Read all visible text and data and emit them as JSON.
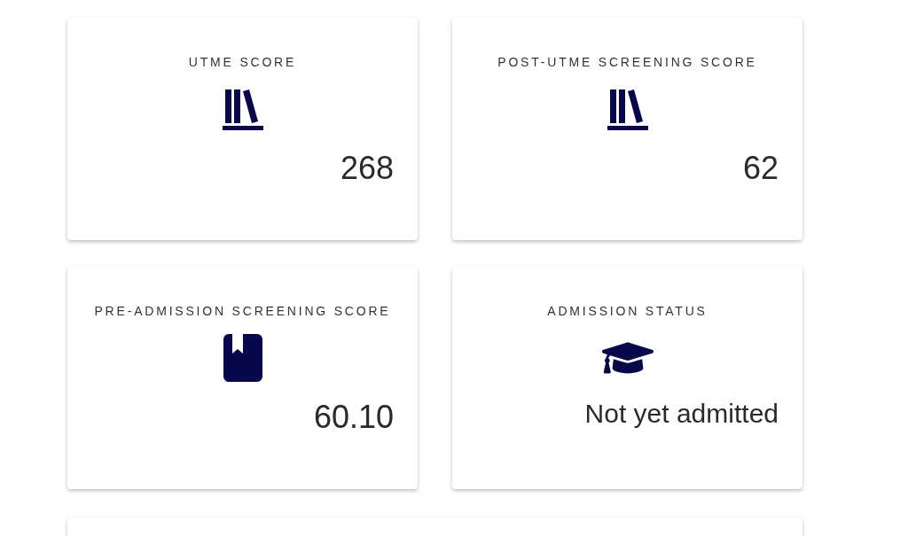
{
  "cards": [
    {
      "title": "UTME SCORE",
      "kind": "shelf",
      "value": "268"
    },
    {
      "title": "POST-UTME SCREENING SCORE",
      "kind": "shelf",
      "value": "62"
    },
    {
      "title": "PRE-ADMISSION SCREENING SCORE",
      "kind": "book",
      "value": "60.10"
    },
    {
      "title": "ADMISSION STATUS",
      "kind": "status",
      "value": "Not yet admitted"
    }
  ]
}
